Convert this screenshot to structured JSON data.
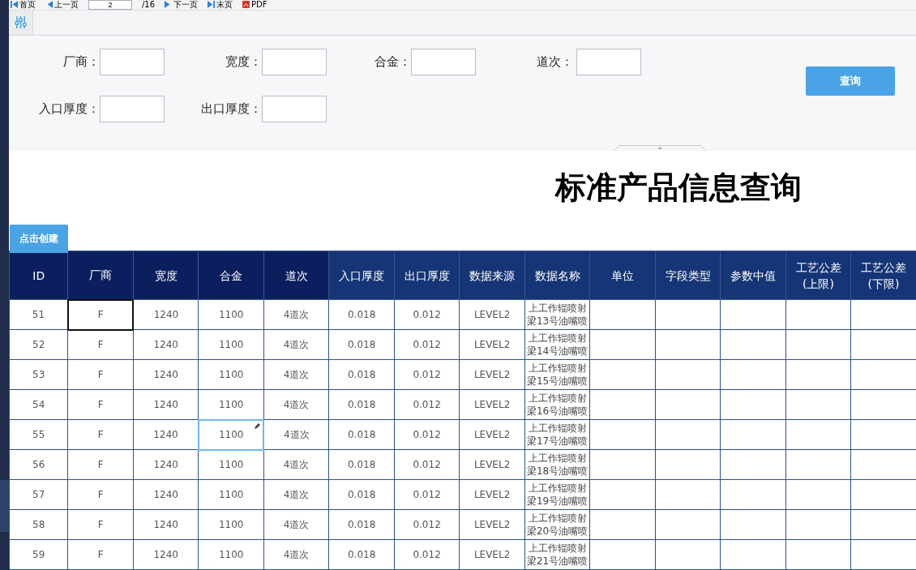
{
  "toolbar": {
    "items": [
      {
        "kind": "first",
        "label": "首页"
      },
      {
        "kind": "prev",
        "label": "上一页"
      },
      {
        "kind": "page",
        "value": "2"
      },
      {
        "kind": "total",
        "label": "/16"
      },
      {
        "kind": "next",
        "label": "下一页"
      },
      {
        "kind": "last",
        "label": "末页"
      },
      {
        "kind": "pdf",
        "label": "PDF"
      }
    ]
  },
  "filters": [
    {
      "label": "厂商："
    },
    {
      "label": "宽度："
    },
    {
      "label": "合金："
    },
    {
      "label": "道次："
    },
    {
      "label": "入口厚度："
    },
    {
      "label": "出口厚度："
    }
  ],
  "query_button": "查询",
  "title": "标准产品信息查询",
  "create_button": "点击创建",
  "table": {
    "columns": [
      {
        "label": "ID",
        "dark": true
      },
      {
        "label": "厂商",
        "dark": true
      },
      {
        "label": "宽度",
        "dark": true
      },
      {
        "label": "合金",
        "dark": true
      },
      {
        "label": "道次",
        "dark": true
      },
      {
        "label": "入口厚度",
        "dark": false
      },
      {
        "label": "出口厚度",
        "dark": false
      },
      {
        "label": "数据来源",
        "dark": false
      },
      {
        "label": "数据名称",
        "dark": false
      },
      {
        "label": "单位",
        "dark": false
      },
      {
        "label": "字段类型",
        "dark": false
      },
      {
        "label": "参数中值",
        "dark": false
      },
      {
        "label": "工艺公差 (上限)",
        "dark": false
      },
      {
        "label": "工艺公差 (下限)",
        "dark": false
      }
    ],
    "rows": [
      {
        "cells": [
          {
            "text": "51",
            "selected": false,
            "editing": false
          },
          {
            "text": "F",
            "selected": true,
            "editing": false
          },
          {
            "text": "1240",
            "selected": false,
            "editing": false
          },
          {
            "text": "1100",
            "selected": false,
            "editing": false
          },
          {
            "text": "4道次",
            "selected": false,
            "editing": false
          },
          {
            "text": "0.018",
            "selected": false,
            "editing": false
          },
          {
            "text": "0.012",
            "selected": false,
            "editing": false
          },
          {
            "text": "LEVEL2",
            "selected": false,
            "editing": false
          },
          {
            "text": "上工作辊喷射梁13号油嘴喷",
            "selected": false,
            "editing": false
          }
        ]
      },
      {
        "cells": [
          {
            "text": "52",
            "selected": false,
            "editing": false
          },
          {
            "text": "F",
            "selected": false,
            "editing": false
          },
          {
            "text": "1240",
            "selected": false,
            "editing": false
          },
          {
            "text": "1100",
            "selected": false,
            "editing": false
          },
          {
            "text": "4道次",
            "selected": false,
            "editing": false
          },
          {
            "text": "0.018",
            "selected": false,
            "editing": false
          },
          {
            "text": "0.012",
            "selected": false,
            "editing": false
          },
          {
            "text": "LEVEL2",
            "selected": false,
            "editing": false
          },
          {
            "text": "上工作辊喷射梁14号油嘴喷",
            "selected": false,
            "editing": false
          }
        ]
      },
      {
        "cells": [
          {
            "text": "53",
            "selected": false,
            "editing": false
          },
          {
            "text": "F",
            "selected": false,
            "editing": false
          },
          {
            "text": "1240",
            "selected": false,
            "editing": false
          },
          {
            "text": "1100",
            "selected": false,
            "editing": false
          },
          {
            "text": "4道次",
            "selected": false,
            "editing": false
          },
          {
            "text": "0.018",
            "selected": false,
            "editing": false
          },
          {
            "text": "0.012",
            "selected": false,
            "editing": false
          },
          {
            "text": "LEVEL2",
            "selected": false,
            "editing": false
          },
          {
            "text": "上工作辊喷射梁15号油嘴喷",
            "selected": false,
            "editing": false
          }
        ]
      },
      {
        "cells": [
          {
            "text": "54",
            "selected": false,
            "editing": false
          },
          {
            "text": "F",
            "selected": false,
            "editing": false
          },
          {
            "text": "1240",
            "selected": false,
            "editing": false
          },
          {
            "text": "1100",
            "selected": false,
            "editing": false
          },
          {
            "text": "4道次",
            "selected": false,
            "editing": false
          },
          {
            "text": "0.018",
            "selected": false,
            "editing": false
          },
          {
            "text": "0.012",
            "selected": false,
            "editing": false
          },
          {
            "text": "LEVEL2",
            "selected": false,
            "editing": false
          },
          {
            "text": "上工作辊喷射梁16号油嘴喷",
            "selected": false,
            "editing": false
          }
        ]
      },
      {
        "cells": [
          {
            "text": "55",
            "selected": false,
            "editing": false
          },
          {
            "text": "F",
            "selected": false,
            "editing": false
          },
          {
            "text": "1240",
            "selected": false,
            "editing": false
          },
          {
            "text": "1100",
            "selected": false,
            "editing": true
          },
          {
            "text": "4道次",
            "selected": false,
            "editing": false
          },
          {
            "text": "0.018",
            "selected": false,
            "editing": false
          },
          {
            "text": "0.012",
            "selected": false,
            "editing": false
          },
          {
            "text": "LEVEL2",
            "selected": false,
            "editing": false
          },
          {
            "text": "上工作辊喷射梁17号油嘴喷",
            "selected": false,
            "editing": false
          }
        ]
      },
      {
        "cells": [
          {
            "text": "56",
            "selected": false,
            "editing": false
          },
          {
            "text": "F",
            "selected": false,
            "editing": false
          },
          {
            "text": "1240",
            "selected": false,
            "editing": false
          },
          {
            "text": "1100",
            "selected": false,
            "editing": false
          },
          {
            "text": "4道次",
            "selected": false,
            "editing": false
          },
          {
            "text": "0.018",
            "selected": false,
            "editing": false
          },
          {
            "text": "0.012",
            "selected": false,
            "editing": false
          },
          {
            "text": "LEVEL2",
            "selected": false,
            "editing": false
          },
          {
            "text": "上工作辊喷射梁18号油嘴喷",
            "selected": false,
            "editing": false
          }
        ]
      },
      {
        "cells": [
          {
            "text": "57",
            "selected": false,
            "editing": false
          },
          {
            "text": "F",
            "selected": false,
            "editing": false
          },
          {
            "text": "1240",
            "selected": false,
            "editing": false
          },
          {
            "text": "1100",
            "selected": false,
            "editing": false
          },
          {
            "text": "4道次",
            "selected": false,
            "editing": false
          },
          {
            "text": "0.018",
            "selected": false,
            "editing": false
          },
          {
            "text": "0.012",
            "selected": false,
            "editing": false
          },
          {
            "text": "LEVEL2",
            "selected": false,
            "editing": false
          },
          {
            "text": "上工作辊喷射梁19号油嘴喷",
            "selected": false,
            "editing": false
          }
        ]
      },
      {
        "cells": [
          {
            "text": "58",
            "selected": false,
            "editing": false
          },
          {
            "text": "F",
            "selected": false,
            "editing": false
          },
          {
            "text": "1240",
            "selected": false,
            "editing": false
          },
          {
            "text": "1100",
            "selected": false,
            "editing": false
          },
          {
            "text": "4道次",
            "selected": false,
            "editing": false
          },
          {
            "text": "0.018",
            "selected": false,
            "editing": false
          },
          {
            "text": "0.012",
            "selected": false,
            "editing": false
          },
          {
            "text": "LEVEL2",
            "selected": false,
            "editing": false
          },
          {
            "text": "上工作辊喷射梁20号油嘴喷",
            "selected": false,
            "editing": false
          }
        ]
      },
      {
        "cells": [
          {
            "text": "59",
            "selected": false,
            "editing": false
          },
          {
            "text": "F",
            "selected": false,
            "editing": false
          },
          {
            "text": "1240",
            "selected": false,
            "editing": false
          },
          {
            "text": "1100",
            "selected": false,
            "editing": false
          },
          {
            "text": "4道次",
            "selected": false,
            "editing": false
          },
          {
            "text": "0.018",
            "selected": false,
            "editing": false
          },
          {
            "text": "0.012",
            "selected": false,
            "editing": false
          },
          {
            "text": "LEVEL2",
            "selected": false,
            "editing": false
          },
          {
            "text": "上工作辊喷射梁21号油嘴喷",
            "selected": false,
            "editing": false
          }
        ]
      }
    ]
  }
}
